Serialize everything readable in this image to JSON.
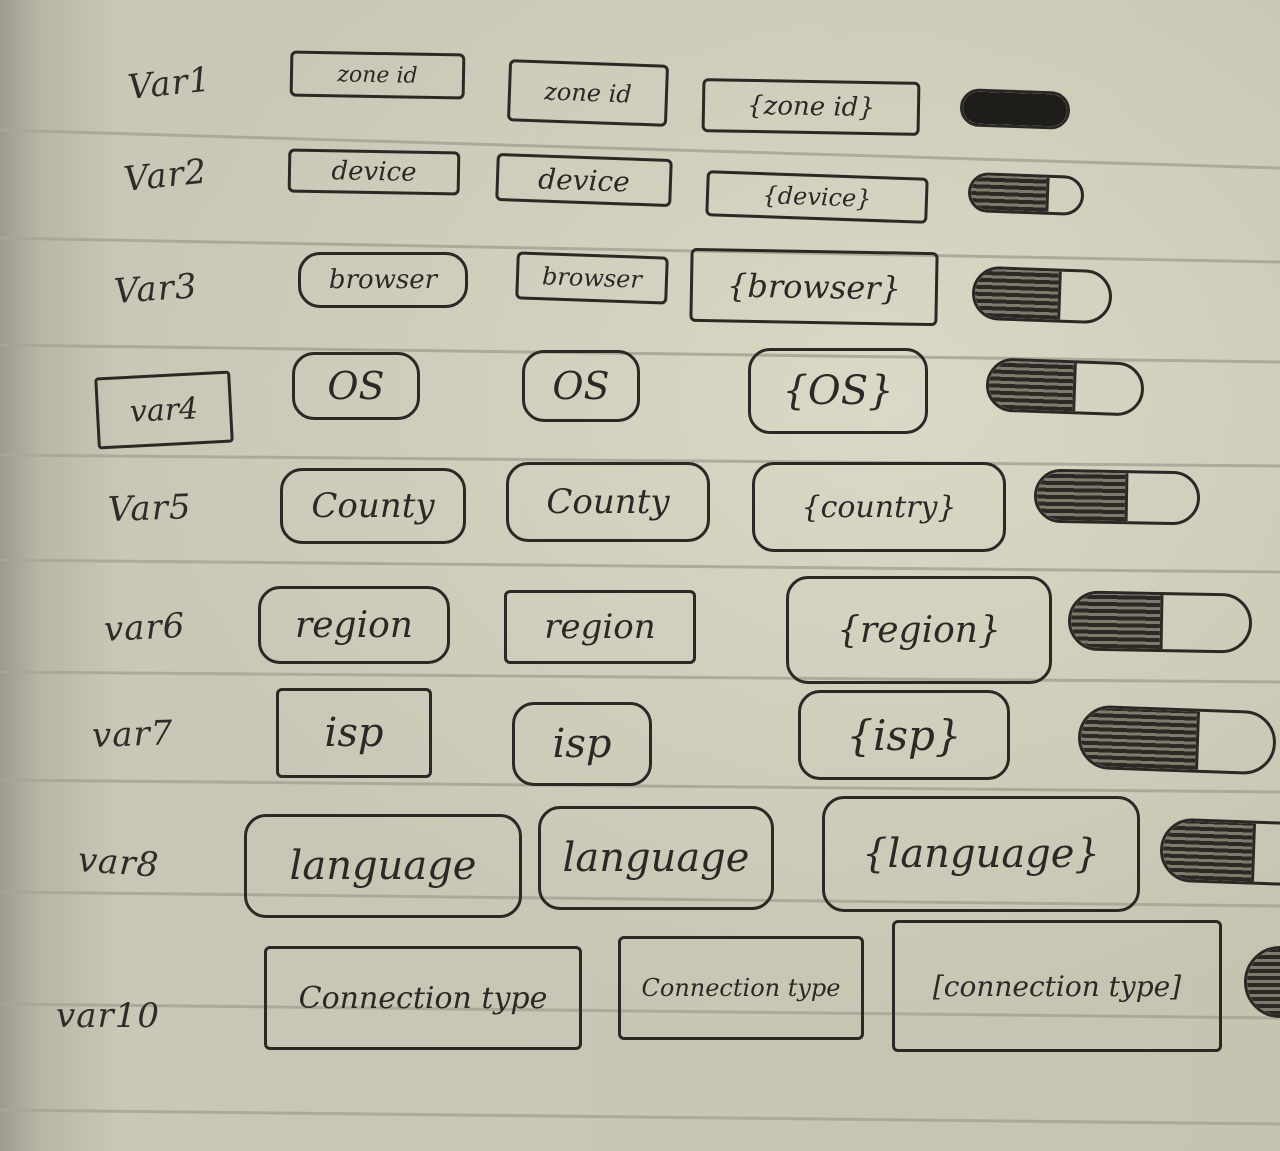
{
  "rows": [
    {
      "label": "Var1",
      "col1": "zone id",
      "col2": "zone id",
      "col3": "{zone id}"
    },
    {
      "label": "Var2",
      "col1": "device",
      "col2": "device",
      "col3": "{device}"
    },
    {
      "label": "Var3",
      "col1": "browser",
      "col2": "browser",
      "col3": "{browser}"
    },
    {
      "label": "var4",
      "col1": "OS",
      "col2": "OS",
      "col3": "{OS}"
    },
    {
      "label": "Var5",
      "col1": "County",
      "col2": "County",
      "col3": "{country}"
    },
    {
      "label": "var6",
      "col1": "region",
      "col2": "region",
      "col3": "{region}"
    },
    {
      "label": "var7",
      "col1": "isp",
      "col2": "isp",
      "col3": "{isp}"
    },
    {
      "label": "var8",
      "col1": "language",
      "col2": "language",
      "col3": "{language}"
    },
    {
      "label": "var10",
      "col1": "Connection type",
      "col2": "Connection type",
      "col3": "[connection type]"
    }
  ],
  "colors": {
    "paper": "#c9c6b4",
    "ink": "#2b2926",
    "rule": "#a9a697"
  },
  "icons": [
    "toggle-switch-icon"
  ]
}
